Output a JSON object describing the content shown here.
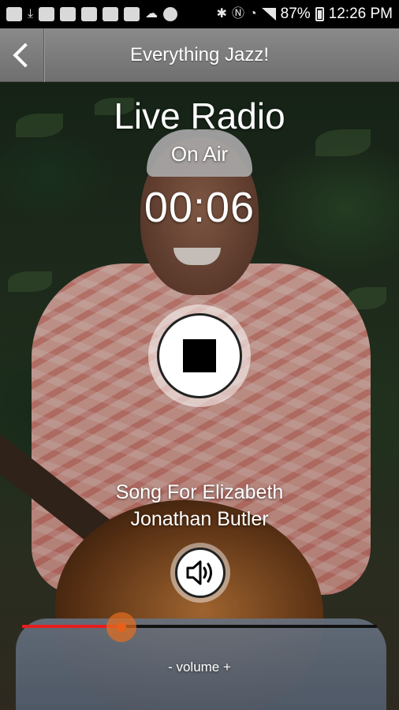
{
  "status_bar": {
    "battery": "87%",
    "time": "12:26 PM",
    "left_icons": [
      "message-icon",
      "download-icon",
      "image-icon",
      "help-icon",
      "mail-icon",
      "flipboard-icon",
      "photo-icon",
      "weather-icon",
      "android-icon"
    ],
    "right_icons": [
      "bluetooth-icon",
      "nfc-icon",
      "wifi-icon",
      "signal-icon",
      "battery-icon"
    ]
  },
  "header": {
    "title": "Everything Jazz!",
    "back_icon": "chevron-left-icon"
  },
  "player": {
    "title": "Live Radio",
    "status": "On Air",
    "elapsed": "00:06",
    "stop_icon": "stop-icon",
    "song": "Song For Elizabeth",
    "artist": "Jonathan Butler",
    "speaker_icon": "speaker-icon",
    "volume_level": 0.28,
    "volume_label": "- volume +"
  },
  "colors": {
    "title_bar": "#7d7d7d",
    "slider_fill": "#e61e1e",
    "slider_thumb": "#e8601a"
  }
}
